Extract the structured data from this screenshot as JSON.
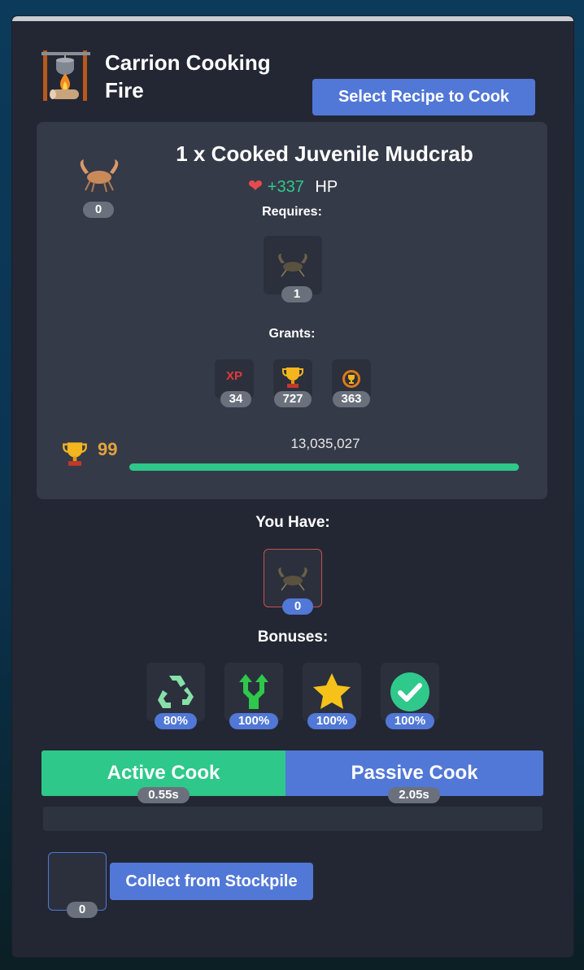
{
  "header": {
    "title": "Carrion Cooking Fire",
    "select_button": "Select Recipe to Cook",
    "icon": "campfire-cooking-pot-icon"
  },
  "recipe": {
    "title": "1 x Cooked Juvenile Mudcrab",
    "dish_icon": "cooked-mudcrab-icon",
    "dish_count": "0",
    "hp_icon": "heart-icon",
    "hp_value": "+337",
    "hp_label": "HP",
    "requires_label": "Requires:",
    "requires": [
      {
        "icon": "raw-mudcrab-icon",
        "count": "1"
      }
    ],
    "grants_label": "Grants:",
    "grants": [
      {
        "icon": "xp-icon",
        "text": "XP",
        "count": "34"
      },
      {
        "icon": "trophy-icon",
        "count": "727"
      },
      {
        "icon": "trophy-coin-icon",
        "count": "363"
      }
    ],
    "level": "99",
    "level_icon": "trophy-icon",
    "xp_total": "13,035,027",
    "xp_progress": 1.0
  },
  "inventory": {
    "label": "You Have:",
    "icon": "raw-mudcrab-icon",
    "count": "0"
  },
  "bonuses": {
    "label": "Bonuses:",
    "items": [
      {
        "icon": "recycle-icon",
        "value": "80%"
      },
      {
        "icon": "double-arrow-icon",
        "value": "100%"
      },
      {
        "icon": "star-icon",
        "value": "100%"
      },
      {
        "icon": "checkmark-icon",
        "value": "100%"
      }
    ]
  },
  "cook": {
    "active_label": "Active Cook",
    "active_time": "0.55s",
    "passive_label": "Passive Cook",
    "passive_time": "2.05s"
  },
  "stockpile": {
    "count": "0",
    "button": "Collect from Stockpile"
  },
  "colors": {
    "green": "#2ec88a",
    "blue": "#5178d7",
    "gold": "#e3a33c",
    "red": "#e24c4c"
  }
}
